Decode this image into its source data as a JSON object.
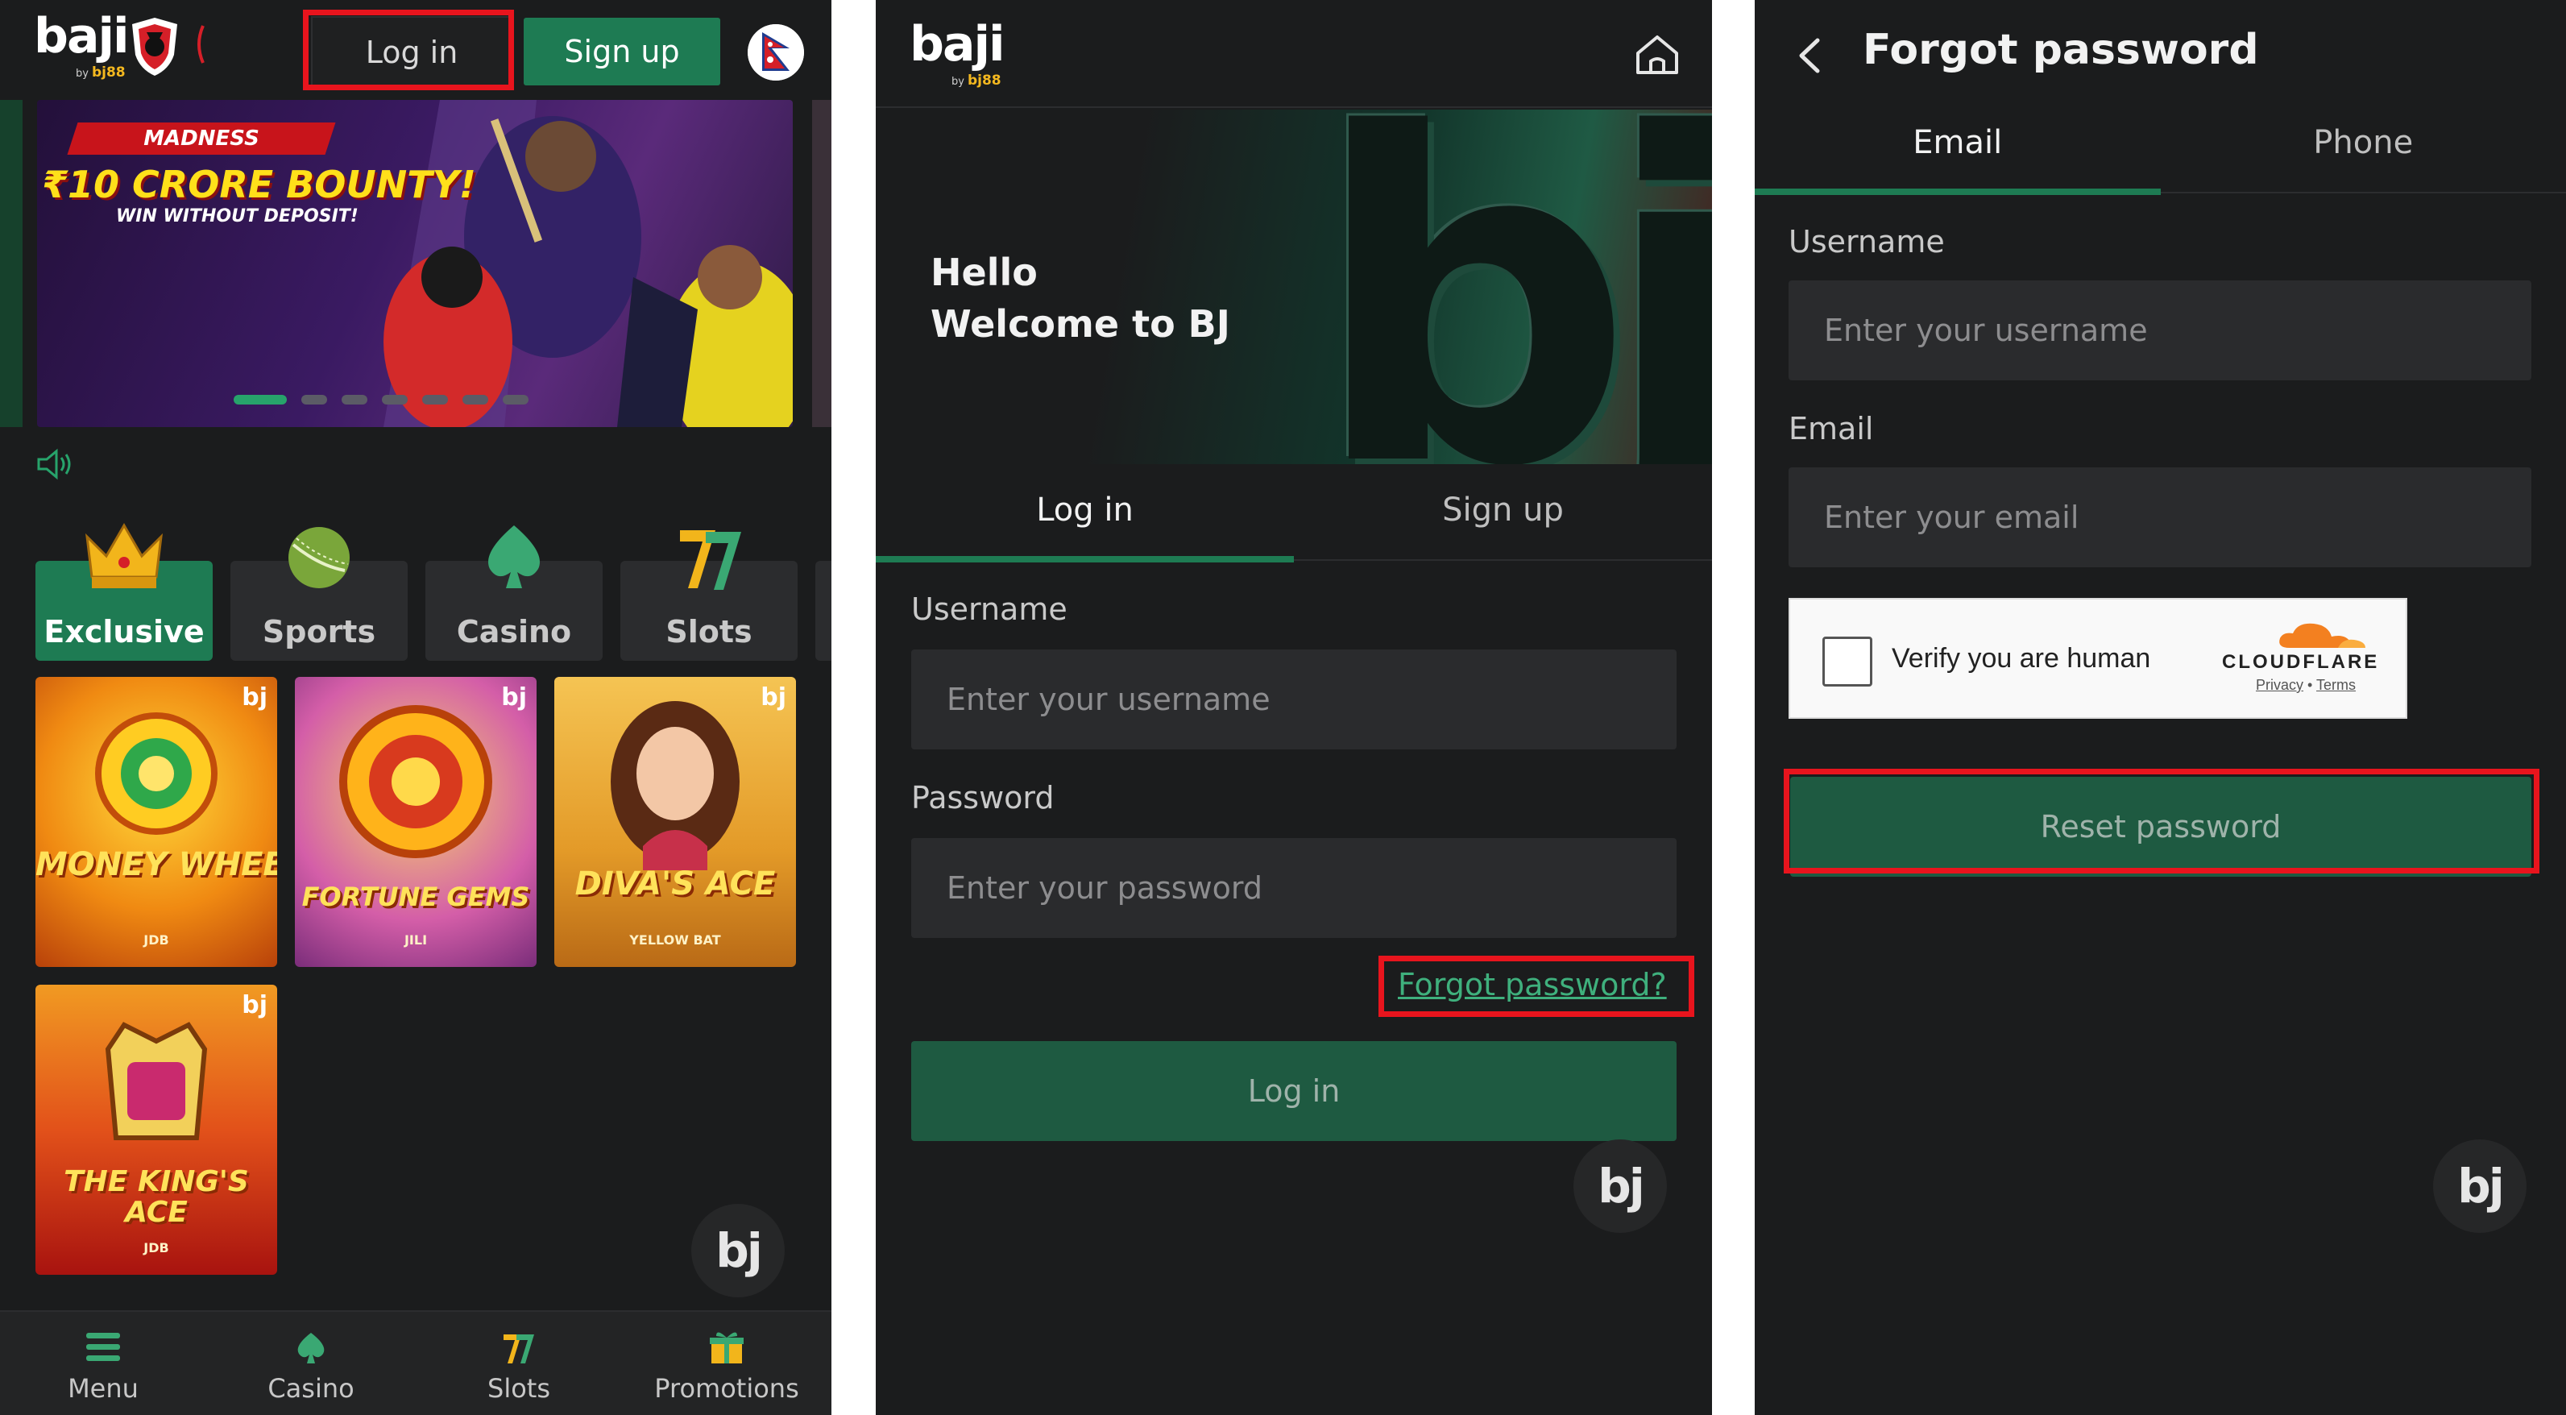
{
  "brand": {
    "logo": "baji",
    "sublogo_by": "by",
    "sublogo_brand": "bj88"
  },
  "home": {
    "login_label": "Log in",
    "signup_label": "Sign up",
    "banner": {
      "tag": "MADNESS",
      "headline": "₹10 CRORE BOUNTY!",
      "subline": "WIN WITHOUT DEPOSIT!",
      "slide_count": 8,
      "active_slide": 1
    },
    "categories": [
      {
        "label": "Exclusive",
        "icon": "crown-icon",
        "active": true
      },
      {
        "label": "Sports",
        "icon": "cricket-ball-icon",
        "active": false
      },
      {
        "label": "Casino",
        "icon": "spade-icon",
        "active": false
      },
      {
        "label": "Slots",
        "icon": "slot-seven-icon",
        "active": false
      }
    ],
    "games": [
      {
        "title": "MONEY WHEEL",
        "provider": "JDB",
        "mark": "bj"
      },
      {
        "title": "FORTUNE GEMS",
        "provider": "JILI",
        "mark": "bj"
      },
      {
        "title": "DIVA'S ACE",
        "provider": "YELLOW BAT",
        "mark": "bj"
      },
      {
        "title": "THE KING'S ACE",
        "provider": "JDB",
        "mark": "bj"
      }
    ],
    "bottom_nav": [
      {
        "label": "Menu",
        "icon": "menu-icon"
      },
      {
        "label": "Casino",
        "icon": "spade-icon"
      },
      {
        "label": "Slots",
        "icon": "slot-seven-icon"
      },
      {
        "label": "Promotions",
        "icon": "gift-icon"
      }
    ],
    "fab_label": "bj"
  },
  "login": {
    "hero_line1": "Hello",
    "hero_line2": "Welcome to BJ",
    "tabs": [
      "Log in",
      "Sign up"
    ],
    "username_label": "Username",
    "username_placeholder": "Enter your username",
    "password_label": "Password",
    "password_placeholder": "Enter your password",
    "forgot_link": "Forgot password?",
    "submit_label": "Log in",
    "fab_label": "bj"
  },
  "forgot": {
    "title": "Forgot password",
    "tabs": [
      "Email",
      "Phone"
    ],
    "username_label": "Username",
    "username_placeholder": "Enter your username",
    "email_label": "Email",
    "email_placeholder": "Enter your email",
    "captcha_text": "Verify you are human",
    "captcha_brand": "CLOUDFLARE",
    "captcha_privacy": "Privacy",
    "captcha_sep": "•",
    "captcha_terms": "Terms",
    "submit_label": "Reset password",
    "fab_label": "bj"
  },
  "colors": {
    "background": "#1b1c1d",
    "accent": "#1e7b53",
    "button_dim": "#1e5a41",
    "field": "#2a2b2d",
    "highlight": "#e8141d",
    "link": "#3fb07d"
  }
}
